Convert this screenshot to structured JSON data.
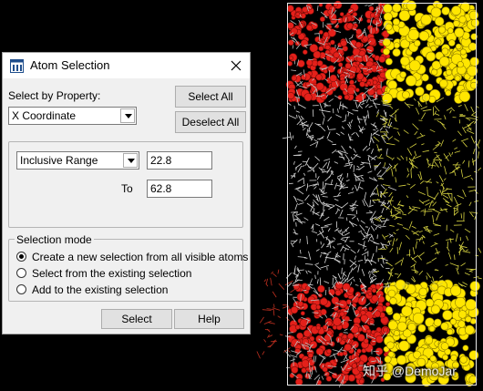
{
  "dialog": {
    "title": "Atom Selection",
    "icon": "dialog-app-icon",
    "select_by_label": "Select by Property:",
    "property_value": "X Coordinate",
    "select_all_label": "Select All",
    "deselect_all_label": "Deselect All",
    "range_mode_value": "Inclusive Range",
    "from_value": "22.8",
    "to_label": "To",
    "to_value": "62.8",
    "selection_mode_title": "Selection mode",
    "modes": [
      {
        "label": "Create a new selection from all visible atoms",
        "checked": true
      },
      {
        "label": "Select from the existing selection",
        "checked": false
      },
      {
        "label": "Add to the existing selection",
        "checked": false
      }
    ],
    "select_button": "Select",
    "help_button": "Help"
  },
  "viewer": {
    "background": "#000000",
    "colors": {
      "oxygen": "#e4201a",
      "sulfur": "#ffe600",
      "stick_white": "#d8d8d8",
      "stick_yellow": "#d4d040"
    }
  },
  "watermark": "知乎 @DemoJar"
}
